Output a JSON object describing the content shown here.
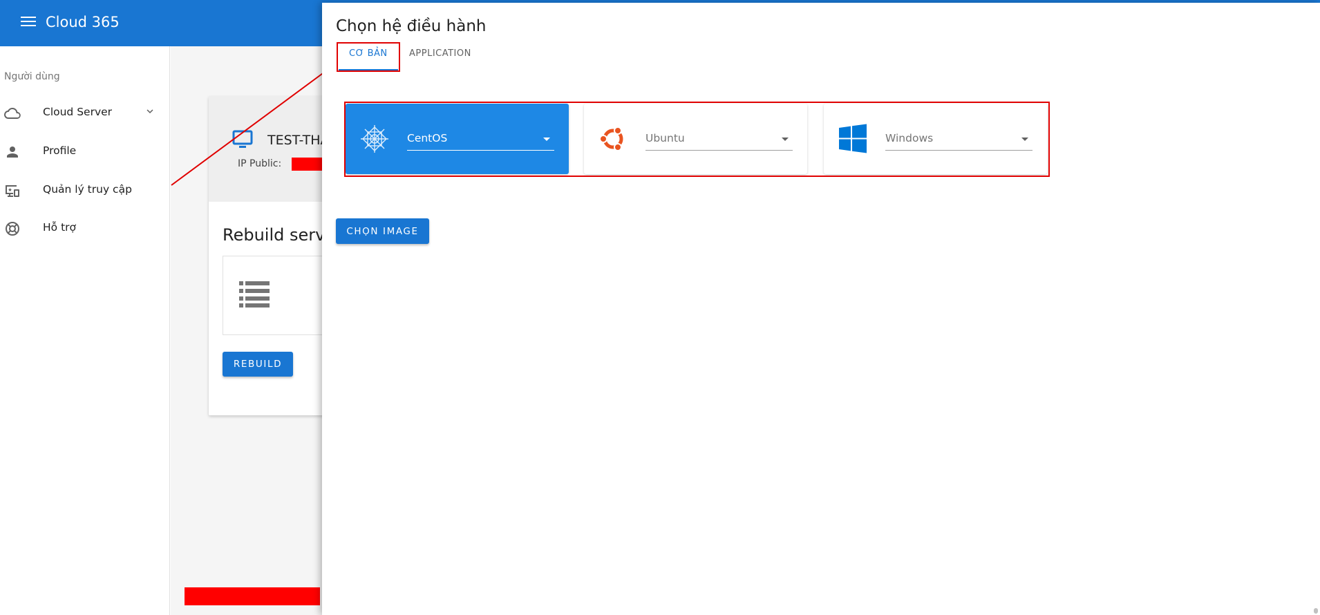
{
  "app": {
    "title": "Cloud 365"
  },
  "sidebar": {
    "subheader": "Người dùng",
    "items": [
      {
        "label": "Cloud Server",
        "icon": "cloud-icon",
        "expandable": true
      },
      {
        "label": "Profile",
        "icon": "person-icon"
      },
      {
        "label": "Quản lý truy cập",
        "icon": "devices-icon"
      },
      {
        "label": "Hỗ trợ",
        "icon": "lifebuoy-icon"
      }
    ]
  },
  "server_card": {
    "name": "TEST-THA",
    "ip_label": "IP Public:",
    "rebuild_title": "Rebuild server",
    "rebuild_button": "REBUILD"
  },
  "dialog": {
    "title": "Chọn hệ điều hành",
    "tabs": [
      {
        "label": "CƠ BẢN",
        "active": true
      },
      {
        "label": "APPLICATION",
        "active": false
      }
    ],
    "os_options": [
      {
        "name": "CentOS",
        "icon": "centos-logo-icon",
        "selected": true
      },
      {
        "name": "Ubuntu",
        "icon": "ubuntu-logo-icon",
        "selected": false
      },
      {
        "name": "Windows",
        "icon": "windows-logo-icon",
        "selected": false
      }
    ],
    "choose_button": "CHỌN IMAGE"
  },
  "colors": {
    "primary": "#1976d2",
    "selected_card": "#1e88e5",
    "annotation": "#e00000",
    "ubuntu": "#e95420",
    "windows": "#0078d7"
  }
}
